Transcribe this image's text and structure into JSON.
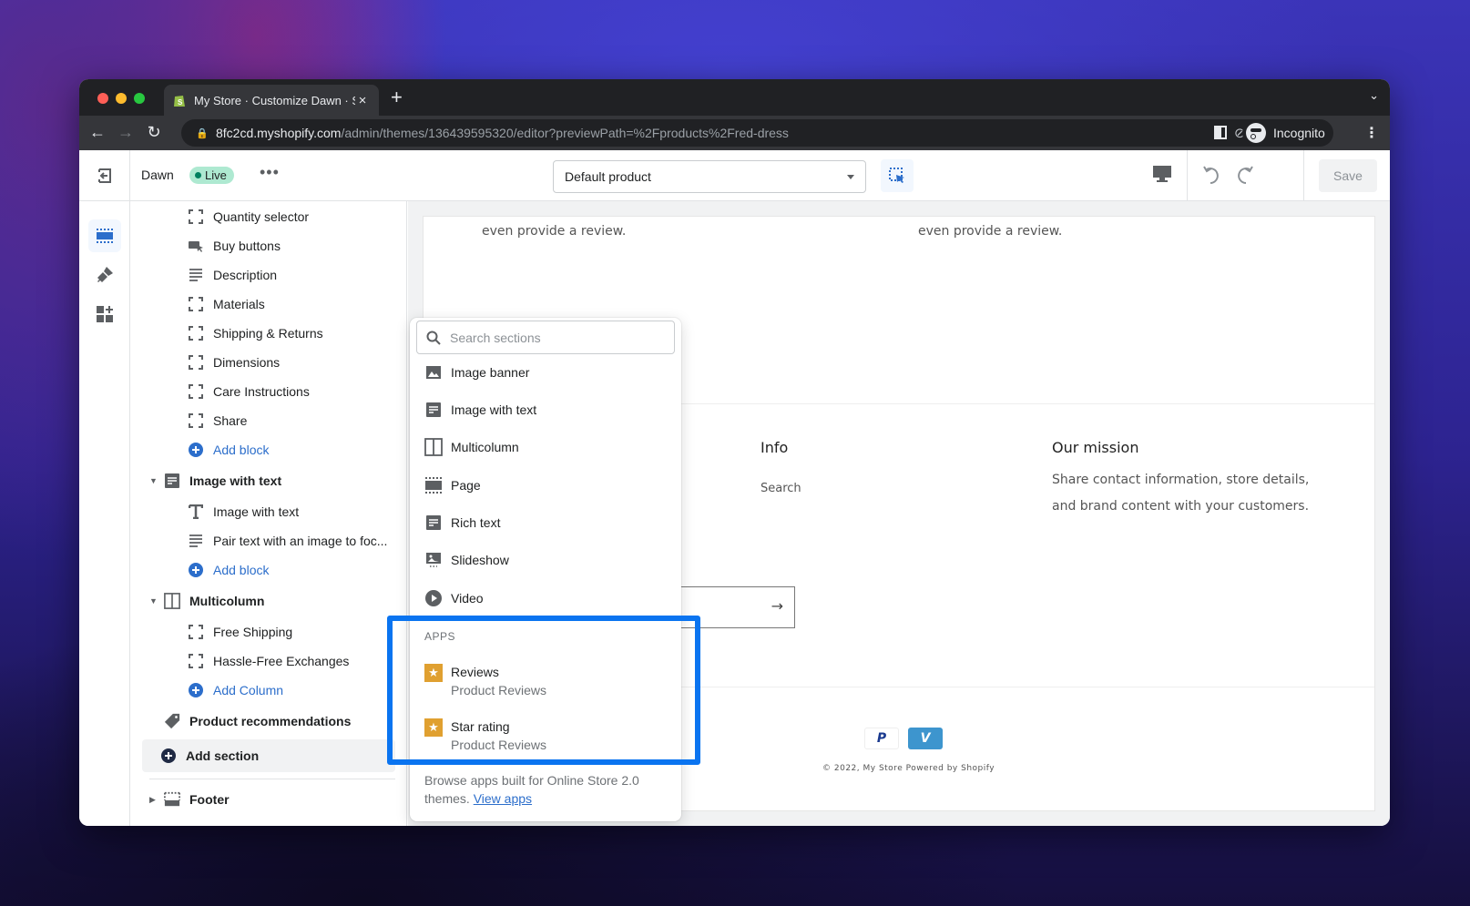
{
  "browser": {
    "tab_title": "My Store · Customize Dawn · Shopify",
    "url_host": "8fc2cd.myshopify.com",
    "url_path": "/admin/themes/136439595320/editor?previewPath=%2Fproducts%2Fred-dress",
    "profile_label": "Incognito",
    "new_tab": "+",
    "close_tab": "×"
  },
  "header": {
    "theme_name": "Dawn",
    "status_badge": "Live",
    "more": "•••",
    "template_select": "Default product",
    "save_label": "Save"
  },
  "sidebar": {
    "product_blocks": [
      {
        "label": "Quantity selector",
        "icon": "block-bracket-icon"
      },
      {
        "label": "Buy buttons",
        "icon": "buy-buttons-icon"
      },
      {
        "label": "Description",
        "icon": "text-lines-icon"
      },
      {
        "label": "Materials",
        "icon": "block-bracket-icon"
      },
      {
        "label": "Shipping & Returns",
        "icon": "block-bracket-icon"
      },
      {
        "label": "Dimensions",
        "icon": "block-bracket-icon"
      },
      {
        "label": "Care Instructions",
        "icon": "block-bracket-icon"
      },
      {
        "label": "Share",
        "icon": "block-bracket-icon"
      }
    ],
    "add_block_1": "Add block",
    "section_image_with_text": "Image with text",
    "iwt_blocks": [
      {
        "label": "Image with text",
        "icon": "heading-T-icon"
      },
      {
        "label": "Pair text with an image to foc...",
        "icon": "text-lines-icon"
      }
    ],
    "add_block_2": "Add block",
    "section_multicolumn": "Multicolumn",
    "mc_blocks": [
      {
        "label": "Free Shipping",
        "icon": "block-bracket-icon"
      },
      {
        "label": "Hassle-Free Exchanges",
        "icon": "block-bracket-icon"
      }
    ],
    "add_column": "Add Column",
    "section_product_recs": "Product recommendations",
    "add_section": "Add section",
    "section_footer": "Footer"
  },
  "preview": {
    "review_text_1": "even provide a review.",
    "review_text_2": "even provide a review.",
    "footer_info_heading": "Info",
    "footer_info_link": "Search",
    "footer_mission_heading": "Our mission",
    "footer_mission_line1": "Share contact information, store details,",
    "footer_mission_line2": "and brand content with your customers.",
    "newsletter_arrow": "→",
    "payment_paypal": "P",
    "payment_venmo": "V",
    "copyright": "© 2022, My Store Powered by Shopify"
  },
  "popover": {
    "search_placeholder": "Search sections",
    "sections": [
      {
        "label": "Image banner",
        "icon": "image-icon"
      },
      {
        "label": "Image with text",
        "icon": "text-block-icon"
      },
      {
        "label": "Multicolumn",
        "icon": "columns-icon"
      },
      {
        "label": "Page",
        "icon": "page-icon"
      },
      {
        "label": "Rich text",
        "icon": "text-block-icon"
      },
      {
        "label": "Slideshow",
        "icon": "slideshow-icon"
      },
      {
        "label": "Video",
        "icon": "play-icon"
      }
    ],
    "apps_heading": "APPS",
    "apps": [
      {
        "title": "Reviews",
        "subtitle": "Product Reviews"
      },
      {
        "title": "Star rating",
        "subtitle": "Product Reviews"
      }
    ],
    "browse_text": "Browse apps built for Online Store 2.0 themes.",
    "view_apps": "View apps"
  },
  "colors": {
    "accent_blue": "#2c6ecb",
    "highlight_blue": "#0a74f0",
    "live_badge_bg": "#aee9d1",
    "app_star": "#e0a030"
  }
}
